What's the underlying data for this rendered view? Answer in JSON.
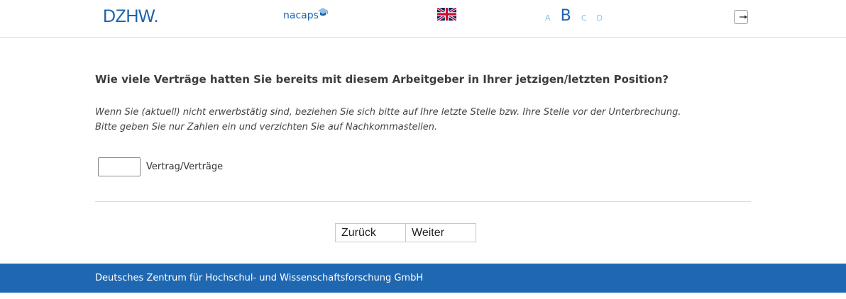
{
  "header": {
    "dzhw_logo": "DZHW.",
    "nacaps_logo": "nacaps",
    "language_flag_icon": "uk-flag-icon",
    "font_sizes": [
      "A",
      "B",
      "C",
      "D"
    ],
    "logout_icon": "logout-icon"
  },
  "question": {
    "text": "Wie viele Verträge hatten Sie bereits mit diesem Arbeitgeber in Ihrer jetzigen/letzten Position?",
    "hint_line1": "Wenn Sie (aktuell) nicht erwerbstätig sind, beziehen Sie sich bitte auf Ihre letzte Stelle bzw. Ihre Stelle vor der Unterbrechung.",
    "hint_line2": "Bitte geben Sie nur Zahlen ein und verzichten Sie auf Nachkommastellen."
  },
  "answer": {
    "value": "",
    "unit_label": "Vertrag/Verträge"
  },
  "navigation": {
    "back_label": "Zurück",
    "next_label": "Weiter"
  },
  "footer": {
    "text": "Deutsches Zentrum für Hochschul- und Wissenschaftsforschung GmbH"
  },
  "colors": {
    "brand_blue": "#1d63ab",
    "footer_blue": "#1f68b1",
    "font_size_inactive": "#8ec1e8"
  }
}
